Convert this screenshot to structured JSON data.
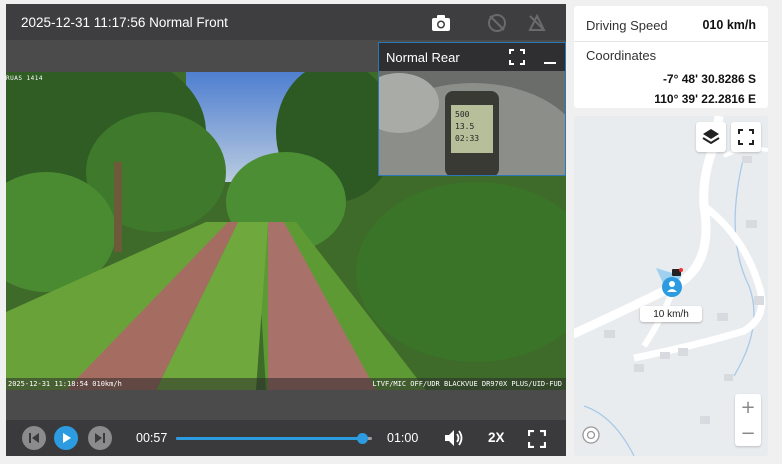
{
  "video": {
    "header_title": "2025-12-31 11:17:56 Normal Front",
    "overlay_top": "RUAS 1414",
    "overlay_timestamp": "2025-12-31 11:18:54 010km/h",
    "overlay_device": "LTVF/MIC OFF/UDR BLACKVUE DR970X PLUS/UID-FUD",
    "rear_title": "Normal Rear",
    "gps_readout": [
      "500",
      "13.5",
      "02:33"
    ]
  },
  "controls": {
    "current_time": "00:57",
    "total_time": "01:00",
    "progress": 0.95,
    "speed_label": "2X"
  },
  "info": {
    "speed_label": "Driving Speed",
    "speed_value": "010 km/h",
    "coordinates_label": "Coordinates",
    "latitude": "-7° 48' 30.8286 S",
    "longitude": "110° 39' 22.2816 E"
  },
  "map": {
    "marker_speed": "10 km/h",
    "zoom_in": "+",
    "zoom_out": "−"
  },
  "colors": {
    "accent": "#2c9be0",
    "header_bg": "#3e3e40",
    "controls_bg": "#3a3a3c"
  }
}
